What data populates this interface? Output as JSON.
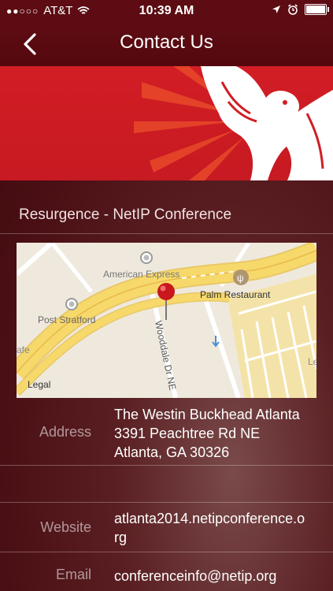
{
  "status_bar": {
    "carrier": "AT&T",
    "time": "10:39 AM",
    "battery_level": 0.92
  },
  "nav": {
    "title": "Contact Us",
    "back_icon": "chevron-left-icon"
  },
  "banner": {
    "logo_icon": "phoenix-icon",
    "colors": {
      "background": "#d21d24",
      "accent": "#ffffff"
    }
  },
  "event": {
    "title": "Resurgence - NetIP Conference"
  },
  "map": {
    "labels": {
      "poi1": "American Express",
      "poi2": "Palm Restaurant",
      "poi3": "Post Stratford",
      "street": "Wooddale Dr NE",
      "legal": "Legal",
      "partial_left": "afe",
      "partial_right": "Le"
    }
  },
  "contact": {
    "address_label": "Address",
    "address_lines": [
      "The Westin Buckhead Atlanta",
      "3391 Peachtree Rd NE",
      "Atlanta, GA 30326"
    ],
    "website_label": "Website",
    "website_lines": [
      "atlanta2014.netipconference.o",
      "rg"
    ],
    "email_label": "Email",
    "email": "conferenceinfo@netip.org"
  }
}
